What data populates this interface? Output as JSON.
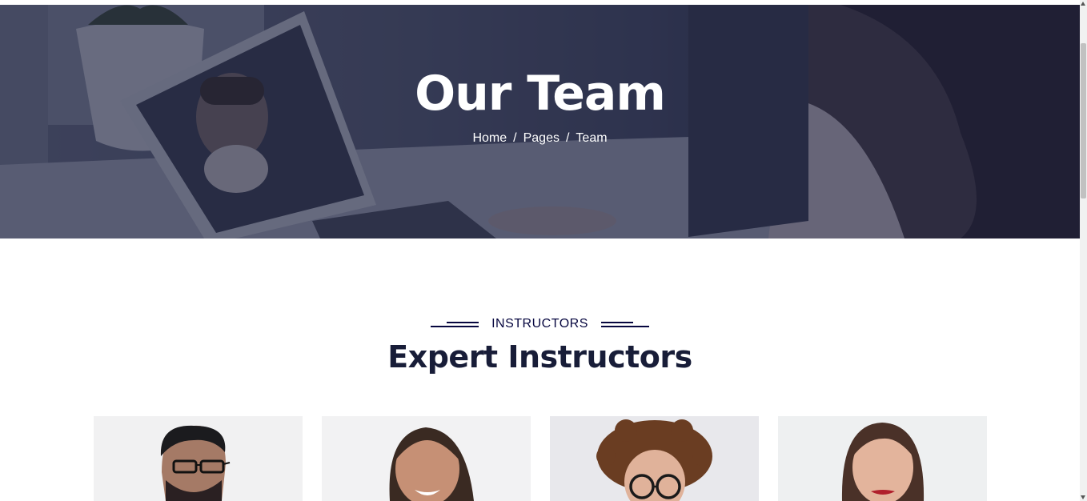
{
  "hero": {
    "title": "Our Team",
    "breadcrumb": [
      {
        "label": "Home"
      },
      {
        "label": "Pages"
      },
      {
        "label": "Team"
      }
    ],
    "separator": "/"
  },
  "section": {
    "eyebrow": "INSTRUCTORS",
    "title": "Expert Instructors"
  },
  "instructors": [
    {
      "photo": "man-with-glasses-photo"
    },
    {
      "photo": "smiling-woman-photo"
    },
    {
      "photo": "curly-haired-man-photo"
    },
    {
      "photo": "woman-red-lips-photo"
    }
  ],
  "colors": {
    "primary": "#06063f",
    "heading": "#181d38",
    "overlay": "#181d38"
  }
}
